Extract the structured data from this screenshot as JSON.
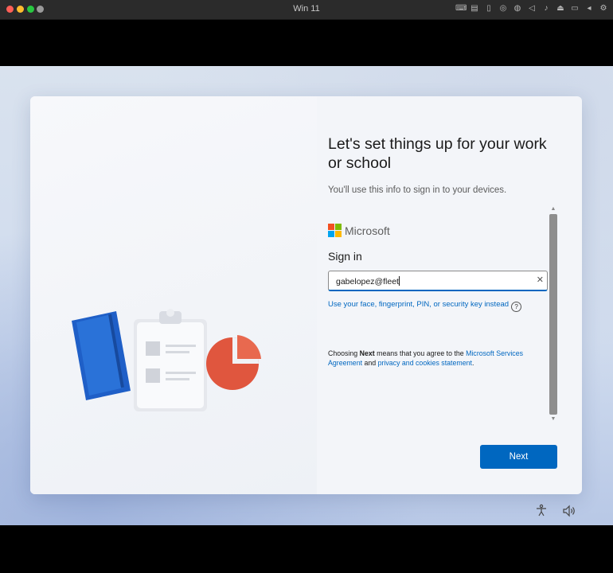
{
  "window": {
    "title": "Win 11"
  },
  "setup": {
    "heading": "Let's set things up for your work or school",
    "subtitle": "You'll use this info to sign in to your devices.",
    "brand": "Microsoft",
    "signin_label": "Sign in",
    "email_value": "gabelopez@fleet",
    "alt_signin": "Use your face, fingerprint, PIN, or security key instead",
    "terms_prefix": "Choosing ",
    "terms_bold": "Next",
    "terms_mid": " means that you agree to the ",
    "terms_link1": "Microsoft Services Agreement",
    "terms_and": " and ",
    "terms_link2": "privacy and cookies statement",
    "terms_end": ".",
    "next_label": "Next"
  },
  "colors": {
    "accent": "#0067c0",
    "ms_red": "#f25022",
    "ms_green": "#7fba00",
    "ms_blue": "#00a4ef",
    "ms_yellow": "#ffb900"
  },
  "icons": [
    "accessibility-icon",
    "volume-icon",
    "help-icon",
    "clear-icon"
  ]
}
